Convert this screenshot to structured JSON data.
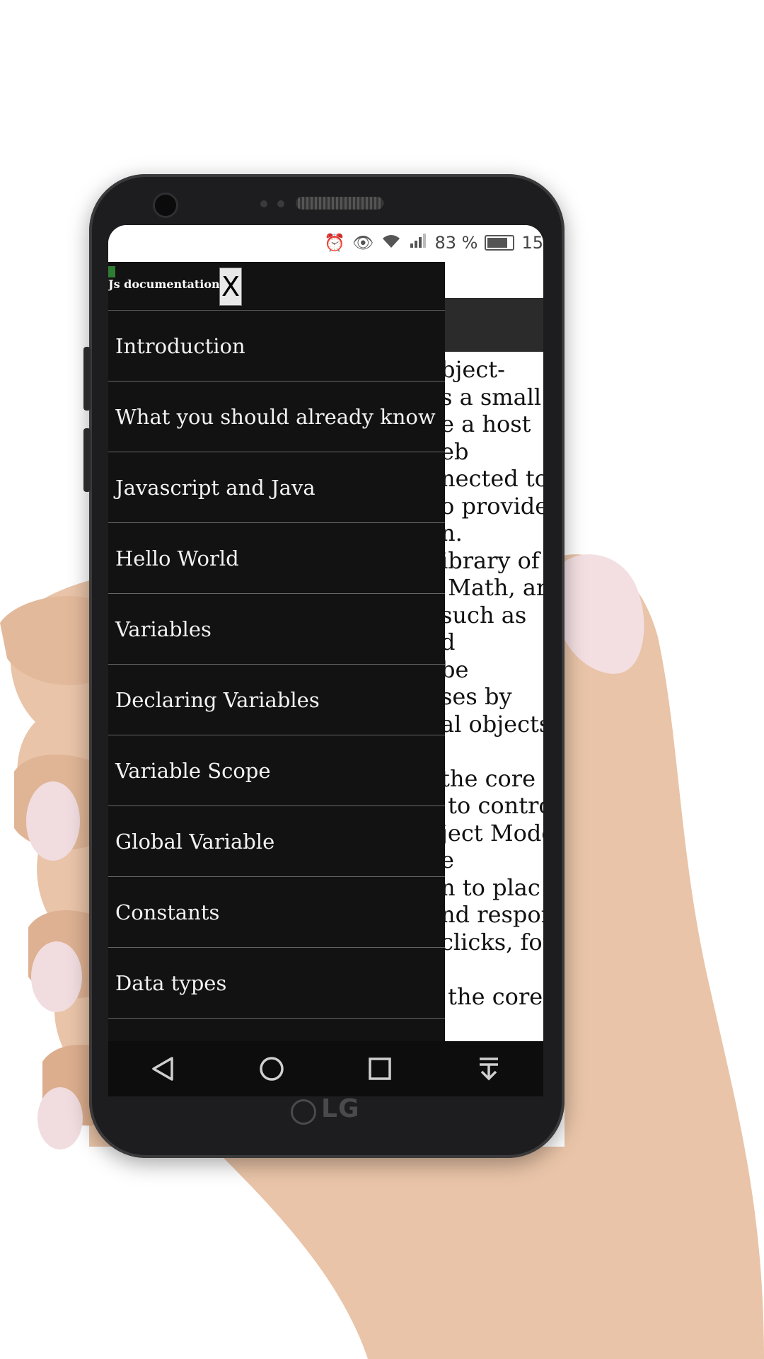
{
  "status_bar": {
    "icons": [
      "alarm-icon",
      "eye-icon",
      "wifi-icon",
      "signal-icon"
    ],
    "battery_text": "83 %",
    "time": "15"
  },
  "drawer": {
    "title": "Js documentation",
    "close_label": "X",
    "items": [
      {
        "label": "Introduction"
      },
      {
        "label": "What you should already know"
      },
      {
        "label": "Javascript and Java"
      },
      {
        "label": "Hello World"
      },
      {
        "label": "Variables"
      },
      {
        "label": "Declaring Variables"
      },
      {
        "label": "Variable Scope"
      },
      {
        "label": "Global Variable"
      },
      {
        "label": "Constants"
      },
      {
        "label": "Data types"
      }
    ]
  },
  "background_content": {
    "text": "bject-\ns a small\ne a host\neb\nnected to\no provide\nn.\nibrary of\n Math, ar\nsuch as\nd\nbe\nses by\nal objects\n\nthe core\n to contro\nject Mode\ne\nn to plac\nnd respon\nclicks, for\n\n the core"
  },
  "device": {
    "brand": "LG"
  },
  "colors": {
    "drawer_bg": "#121212",
    "toolbar_bg": "#2b2b2b",
    "divider": "#666666"
  }
}
